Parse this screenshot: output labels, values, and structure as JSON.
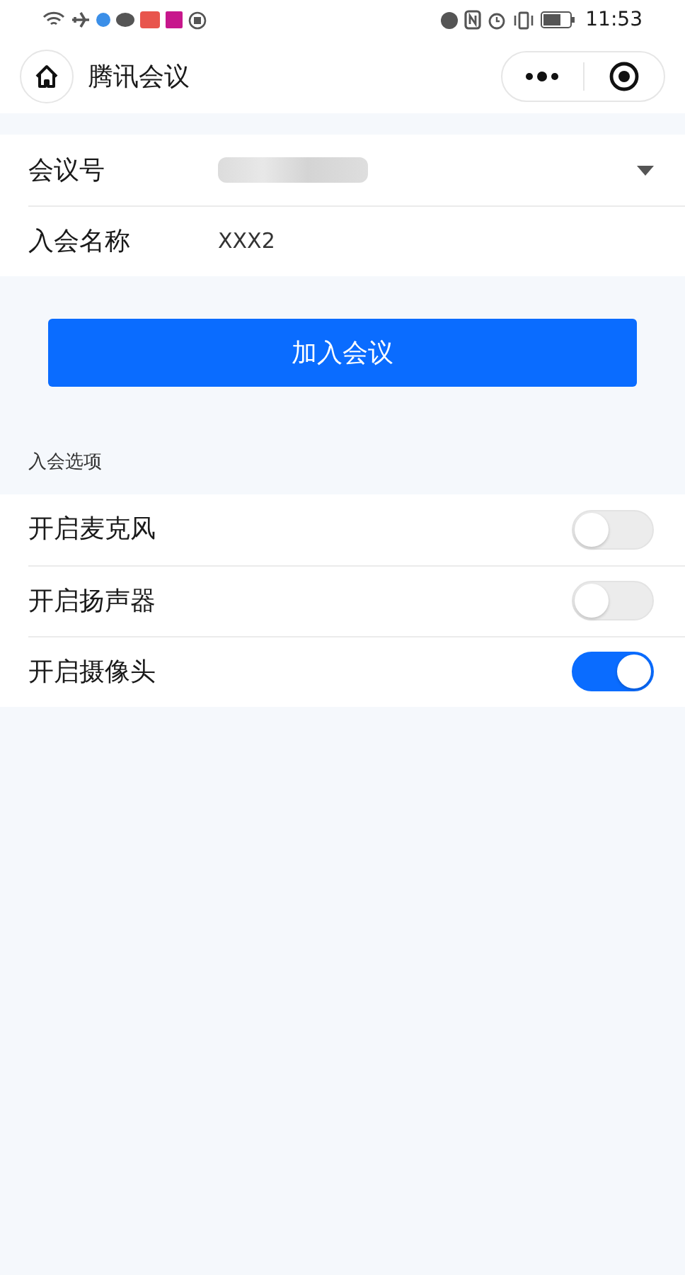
{
  "status_bar": {
    "time": "11:53"
  },
  "header": {
    "title": "腾讯会议"
  },
  "form": {
    "fields": [
      {
        "kind": "dropdown",
        "label": "会议号",
        "redacted": true
      },
      {
        "kind": "text",
        "label": "入会名称",
        "value": "XXX2"
      }
    ]
  },
  "join_button": "加入会议",
  "options": {
    "title": "入会选项",
    "items": [
      {
        "label": "开启麦克风",
        "on": false
      },
      {
        "label": "开启扬声器",
        "on": false
      },
      {
        "label": "开启摄像头",
        "on": true
      }
    ]
  }
}
